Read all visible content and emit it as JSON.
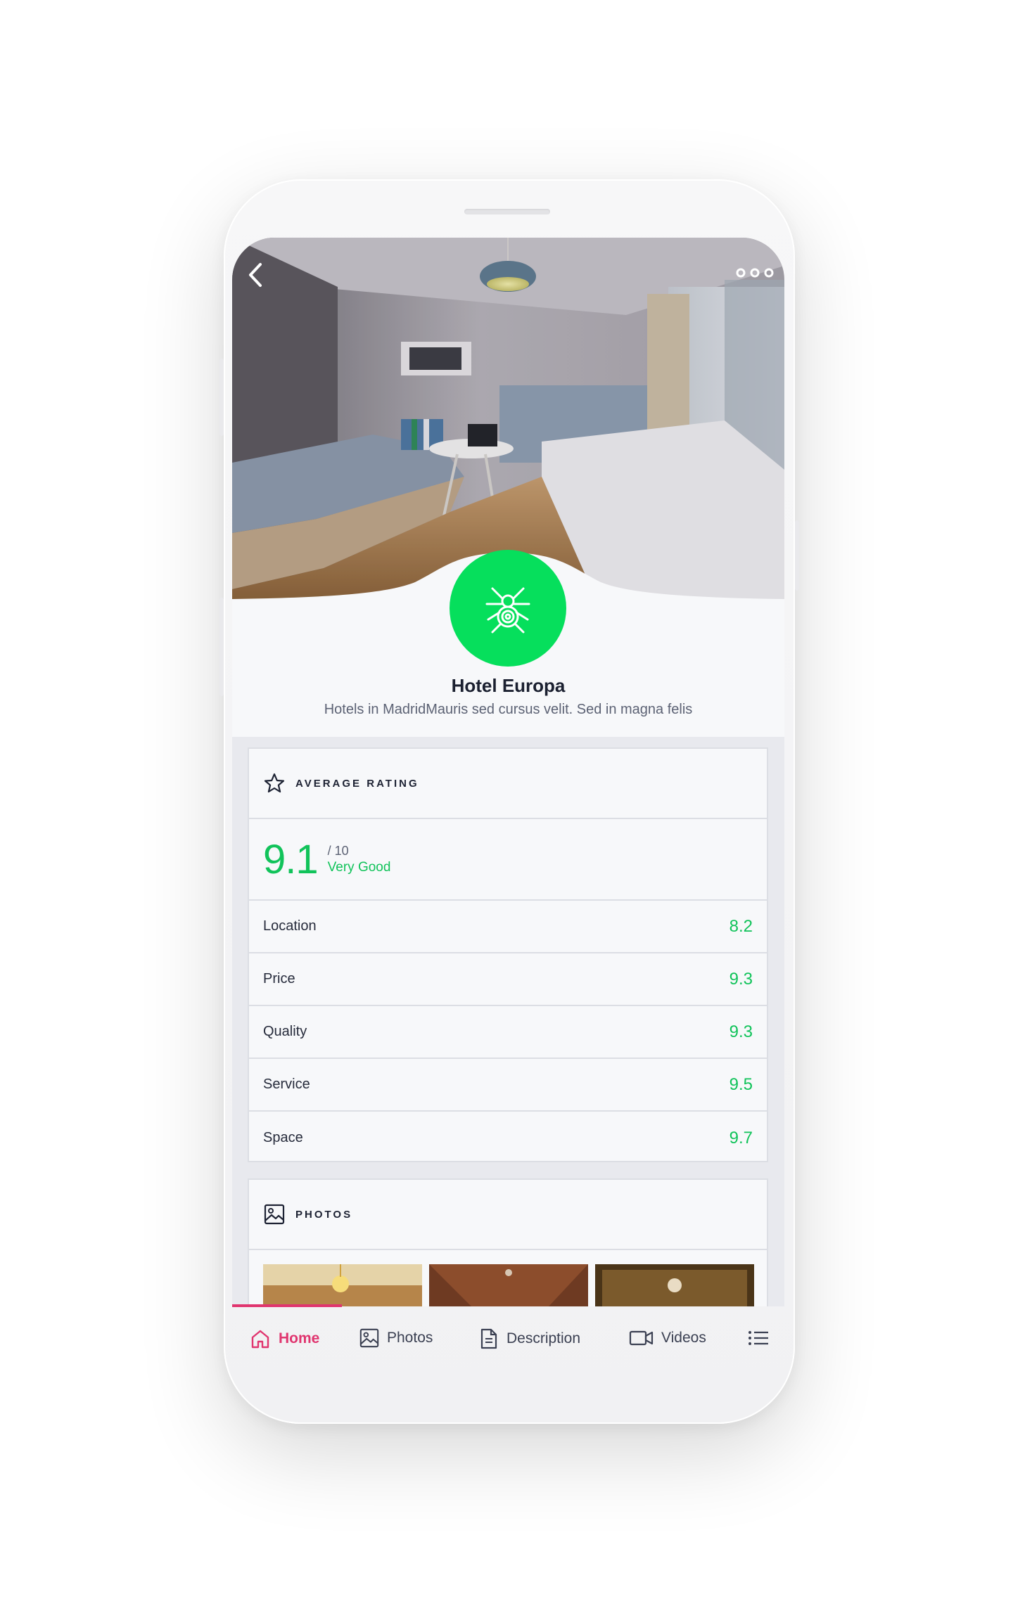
{
  "hotel": {
    "name": "Hotel Europa",
    "description": "Hotels in MadridMauris sed cursus velit. Sed in magna felis"
  },
  "rating": {
    "section_label": "AVERAGE RATING",
    "score": "9.1",
    "max": "/ 10",
    "verdict": "Very Good",
    "metrics": [
      {
        "name": "Location",
        "value": "8.2"
      },
      {
        "name": "Price",
        "value": "9.3"
      },
      {
        "name": "Quality",
        "value": "9.3"
      },
      {
        "name": "Service",
        "value": "9.5"
      },
      {
        "name": "Space",
        "value": "9.7"
      }
    ]
  },
  "photos": {
    "section_label": "PHOTOS"
  },
  "nav": {
    "items": [
      {
        "label": "Home",
        "icon": "home-icon",
        "active": true
      },
      {
        "label": "Photos",
        "icon": "image-icon",
        "active": false
      },
      {
        "label": "Description",
        "icon": "document-icon",
        "active": false
      },
      {
        "label": "Videos",
        "icon": "video-icon",
        "active": false
      },
      {
        "label": "",
        "icon": "list-icon",
        "active": false
      }
    ]
  },
  "colors": {
    "accent_green": "#06df5c",
    "score_green": "#11c35a",
    "active_pink": "#e0356f"
  }
}
